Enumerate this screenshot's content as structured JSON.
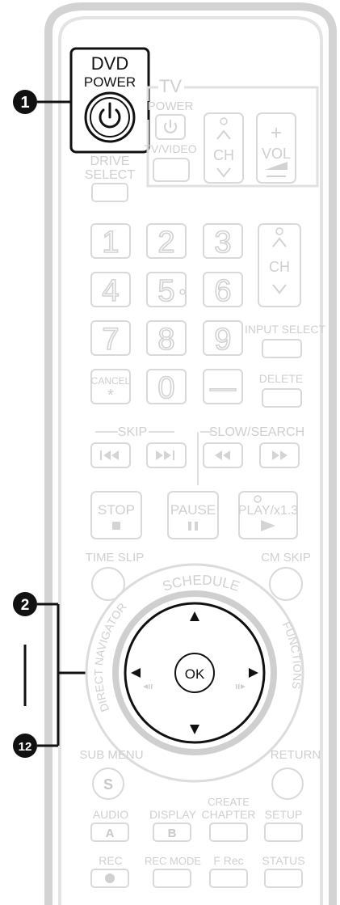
{
  "callouts": [
    "1",
    "2",
    "12"
  ],
  "power": {
    "line1": "DVD",
    "line2": "POWER"
  },
  "tv": {
    "title": "TV",
    "power": "POWER",
    "tvvideo": "TV/VIDEO",
    "ch": "CH",
    "vol": "VOL"
  },
  "drive_select": {
    "line1": "DRIVE",
    "line2": "SELECT"
  },
  "numpad": {
    "keys": [
      "1",
      "2",
      "3",
      "4",
      "5",
      "6",
      "7",
      "8",
      "9",
      "0",
      "—"
    ],
    "ch": "CH"
  },
  "labels": {
    "input_select": "INPUT SELECT",
    "cancel": "CANCEL",
    "cancel_sym": "*",
    "delete": "DELETE",
    "skip": "SKIP",
    "slow_search": "SLOW/SEARCH",
    "stop": "STOP",
    "pause": "PAUSE",
    "play": "PLAY/x1.3",
    "time_slip": "TIME SLIP",
    "cm_skip": "CM SKIP",
    "schedule": "SCHEDULE",
    "direct_navigator": "DIRECT NAVIGATOR",
    "functions": "FUNCTIONS",
    "ok": "OK",
    "sub_menu": "SUB MENU",
    "sub_menu_key": "S",
    "return": "RETURN",
    "audio": "AUDIO",
    "audio_key": "A",
    "display": "DISPLAY",
    "display_key": "B",
    "create_chapter_1": "CREATE",
    "create_chapter_2": "CHAPTER",
    "setup": "SETUP",
    "rec": "REC",
    "rec_mode": "REC MODE",
    "f_rec": "F Rec",
    "status": "STATUS"
  }
}
